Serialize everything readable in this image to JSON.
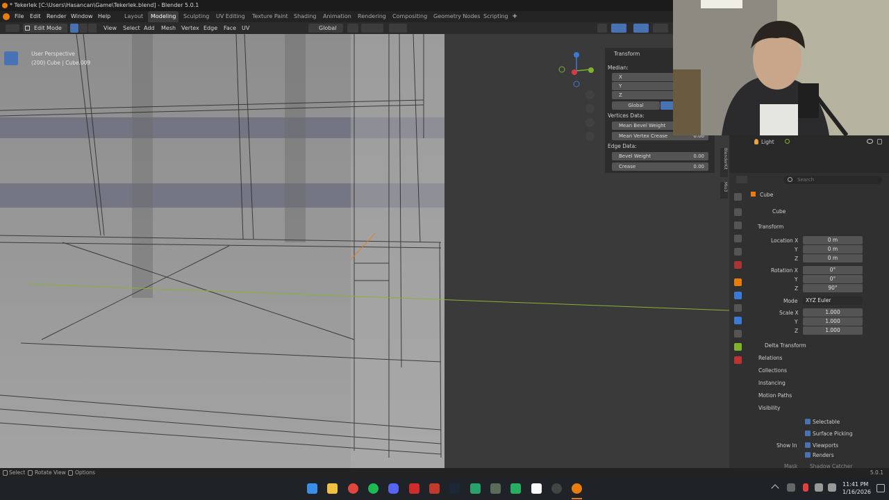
{
  "window": {
    "title": "* Tekerlek [C:\\Users\\Hasancan\\Game\\Tekerlek.blend] - Blender 5.0.1"
  },
  "menu": {
    "items": [
      "File",
      "Edit",
      "Render",
      "Window",
      "Help"
    ],
    "workspaces": [
      "Layout",
      "Modeling",
      "Sculpting",
      "UV Editing",
      "Texture Paint",
      "Shading",
      "Animation",
      "Rendering",
      "Compositing",
      "Geometry Nodes",
      "Scripting"
    ],
    "active_workspace": "Modeling",
    "add_tab": "+"
  },
  "viewport_header": {
    "mode": "Edit Mode",
    "menus": [
      "View",
      "Select",
      "Add",
      "Mesh",
      "Vertex",
      "Edge",
      "Face",
      "UV"
    ],
    "transform_orientation": "Global"
  },
  "viewport": {
    "perspective": "User Perspective",
    "object_info": "(200) Cube | Cube.009",
    "axis_labels": {
      "x": "X",
      "y": "Y"
    }
  },
  "n_panel": {
    "title": "Transform",
    "median_label": "Median:",
    "axes": [
      "X",
      "Y",
      "Z"
    ],
    "global_btn": "Global",
    "vertices_data_label": "Vertices Data:",
    "mean_bevel": "Mean Bevel Weight",
    "mean_crease": "Mean Vertex Crease",
    "mean_crease_value": "0.00",
    "edge_data_label": "Edge Data:",
    "bevel_weight": "Bevel Weight",
    "bevel_weight_value": "0.00",
    "crease": "Crease",
    "crease_value": "0.00",
    "tabs": [
      "BlenderKit",
      "Mio3"
    ]
  },
  "outliner": {
    "item": "Light"
  },
  "properties": {
    "search_placeholder": "Search",
    "object_name": "Cube",
    "data_name": "Cube",
    "transform_label": "Transform",
    "location": {
      "label": "Location X",
      "x": "0 m",
      "y": "0 m",
      "z": "0 m"
    },
    "rotation": {
      "label": "Rotation X",
      "x": "0°",
      "y": "0°",
      "z": "90°"
    },
    "mode_label": "Mode",
    "mode_value": "XYZ Euler",
    "scale": {
      "label": "Scale X",
      "x": "1.000",
      "y": "1.000",
      "z": "1.000"
    },
    "axis_y": "Y",
    "axis_z": "Z",
    "sections": [
      "Delta Transform",
      "Relations",
      "Collections",
      "Instancing",
      "Motion Paths",
      "Visibility"
    ],
    "visibility": {
      "selectable": "Selectable",
      "surface_picking": "Surface Picking",
      "show_in": "Show In",
      "viewports": "Viewports",
      "renders": "Renders",
      "mask": "Mask",
      "shadow_catcher": "Shadow Catcher"
    }
  },
  "status": {
    "select": "Select",
    "rotate": "Rotate View",
    "options": "Options",
    "version": "5.0.1"
  },
  "taskbar": {
    "time": "11:41 PM",
    "date": "1/16/2026"
  },
  "colors": {
    "accent": "#4772b3",
    "orange": "#e87d0d",
    "x_axis": "#d83a4b",
    "y_axis": "#7fb32a",
    "z_axis": "#3b7bd6"
  }
}
